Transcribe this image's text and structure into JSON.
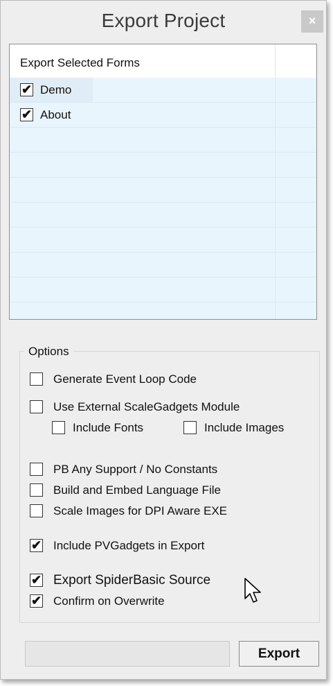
{
  "window": {
    "title": "Export Project",
    "close_label": "×"
  },
  "list": {
    "header": "Export Selected Forms",
    "items": [
      {
        "label": "Demo",
        "checked": true
      },
      {
        "label": "About",
        "checked": true
      }
    ]
  },
  "options": {
    "legend": "Options",
    "generate_event_loop": {
      "label": "Generate Event Loop Code",
      "checked": false
    },
    "use_external_scalegadgets": {
      "label": "Use External ScaleGadgets Module",
      "checked": false
    },
    "include_fonts": {
      "label": "Include Fonts",
      "checked": false
    },
    "include_images": {
      "label": "Include Images",
      "checked": false
    },
    "pb_any_support": {
      "label": "PB Any Support / No Constants",
      "checked": false
    },
    "build_language_file": {
      "label": "Build and Embed Language File",
      "checked": false
    },
    "scale_images_dpi": {
      "label": "Scale Images for DPI Aware EXE",
      "checked": false
    },
    "include_pvgadgets": {
      "label": "Include PVGadgets in Export",
      "checked": true
    },
    "export_spiderbasic": {
      "label": "Export SpiderBasic Source",
      "checked": true
    },
    "confirm_overwrite": {
      "label": "Confirm on Overwrite",
      "checked": true
    }
  },
  "footer": {
    "status_text": "",
    "export_label": "Export"
  },
  "check_mark": "✔"
}
